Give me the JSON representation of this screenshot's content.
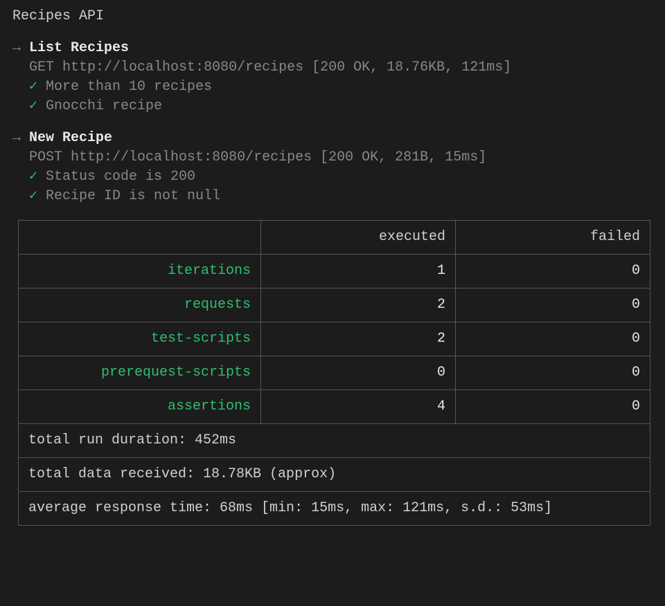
{
  "collection": {
    "title": "Recipes API"
  },
  "requests": [
    {
      "name": "List Recipes",
      "method": "GET",
      "url": "http://localhost:8080/recipes",
      "status": "200 OK",
      "size": "18.76KB",
      "time": "121ms",
      "asserts": [
        {
          "pass": true,
          "label": "More than 10 recipes"
        },
        {
          "pass": true,
          "label": "Gnocchi recipe"
        }
      ]
    },
    {
      "name": "New Recipe",
      "method": "POST",
      "url": "http://localhost:8080/recipes",
      "status": "200 OK",
      "size": "281B",
      "time": "15ms",
      "asserts": [
        {
          "pass": true,
          "label": "Status code is 200"
        },
        {
          "pass": true,
          "label": "Recipe ID is not null"
        }
      ]
    }
  ],
  "summary": {
    "headers": {
      "executed": "executed",
      "failed": "failed"
    },
    "rows": [
      {
        "label": "iterations",
        "executed": "1",
        "failed": "0"
      },
      {
        "label": "requests",
        "executed": "2",
        "failed": "0"
      },
      {
        "label": "test-scripts",
        "executed": "2",
        "failed": "0"
      },
      {
        "label": "prerequest-scripts",
        "executed": "0",
        "failed": "0"
      },
      {
        "label": "assertions",
        "executed": "4",
        "failed": "0"
      }
    ],
    "footers": {
      "duration": "total run duration: 452ms",
      "received": "total data received: 18.78KB (approx)",
      "avg": "average response time: 68ms [min: 15ms, max: 121ms, s.d.: 53ms]"
    }
  },
  "glyphs": {
    "arrow": "→",
    "check": "✓"
  }
}
